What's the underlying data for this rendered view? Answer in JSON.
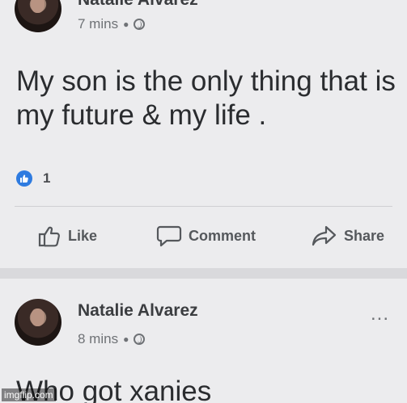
{
  "post1": {
    "author": "Natalie Alvarez",
    "time": "7 mins",
    "text": "My son is the only thing that is my future & my life .",
    "reaction_count": "1"
  },
  "actions": {
    "like": "Like",
    "comment": "Comment",
    "share": "Share"
  },
  "post2": {
    "author": "Natalie Alvarez",
    "time": "8 mins",
    "text": "Who got xanies",
    "more": "..."
  },
  "watermark": "imgflip.com",
  "colors": {
    "like_blue": "#2e7be0",
    "background": "#ececee"
  },
  "icons": [
    "globe-icon",
    "thumbs-up-icon",
    "comment-icon",
    "share-icon",
    "more-icon"
  ]
}
